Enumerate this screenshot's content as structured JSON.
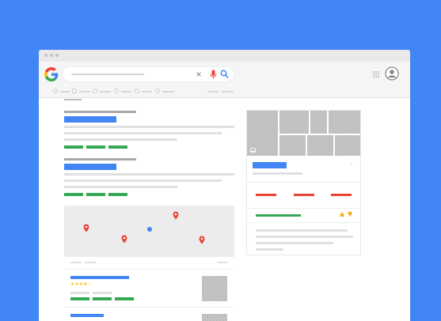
{
  "search": {
    "clear_glyph": "×",
    "placeholder_icon": "placeholder-line"
  },
  "icons": {
    "logo": "google-g-logo",
    "clear": "close-icon",
    "mic": "mic-icon",
    "search": "search-icon",
    "apps": "apps-grid-icon",
    "account": "account-avatar-icon",
    "share": "share-icon",
    "thumbs_up": "thumbs-up-icon",
    "thumbs_down": "thumbs-down-icon",
    "image": "image-icon"
  },
  "results": {
    "review_stars": "★★★★☆"
  },
  "knowledge_panel": {
    "share_glyph": "<",
    "thumbs_up_glyph": "👍",
    "thumbs_down_glyph": "👎"
  },
  "colors": {
    "background": "#4285f4",
    "link_blue": "#4285f4",
    "green": "#34a853",
    "red": "#ea4335",
    "star": "#fbbc05"
  }
}
